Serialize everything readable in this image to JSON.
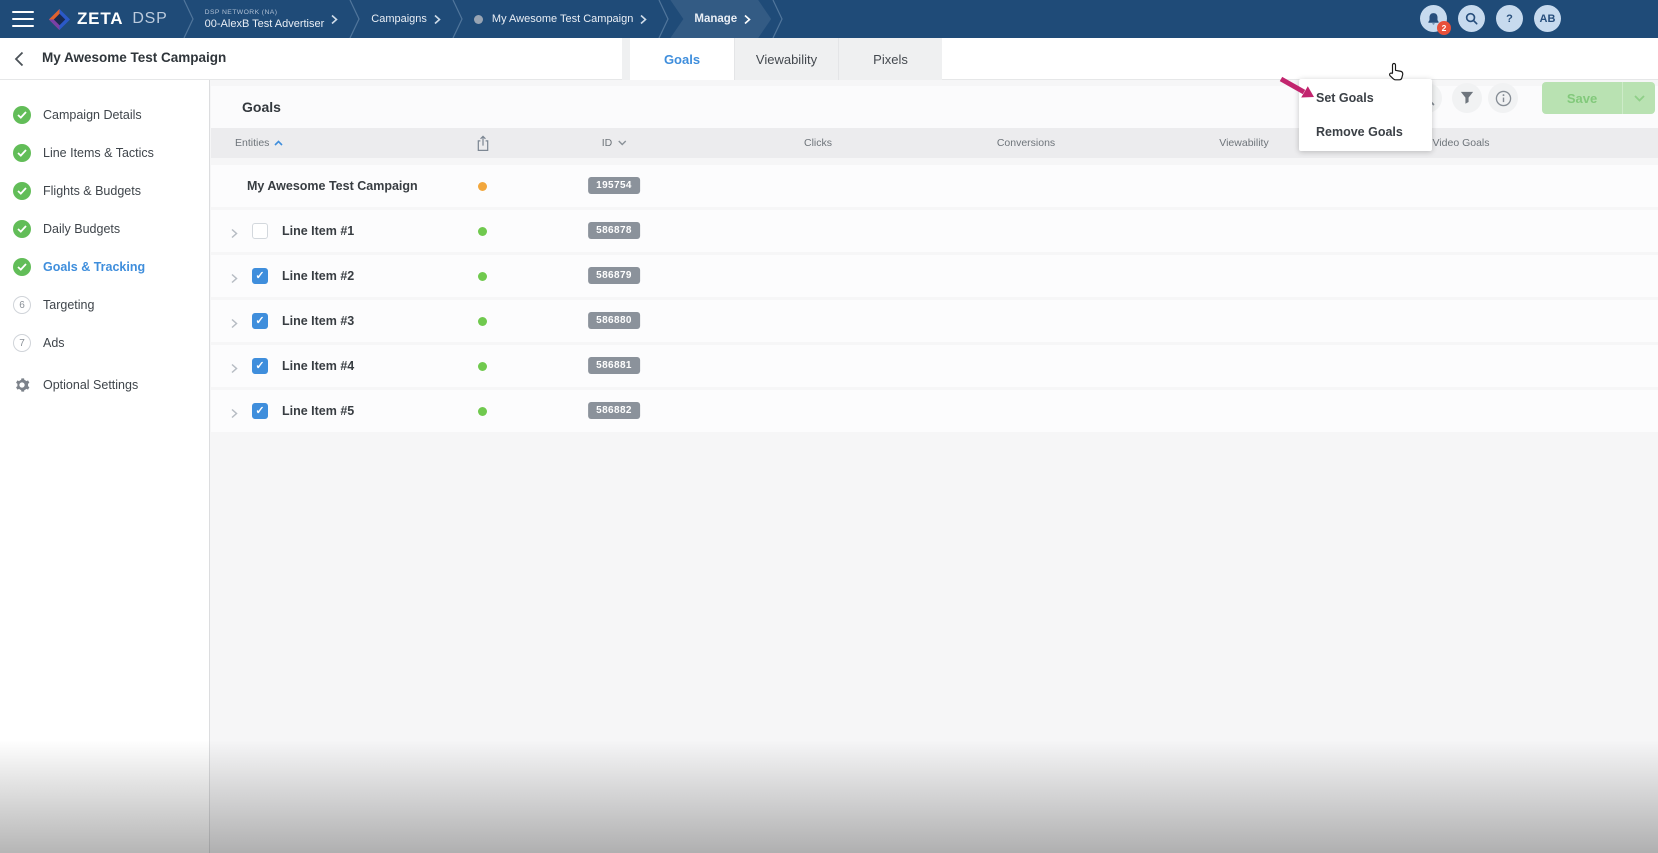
{
  "colors": {
    "topbar_bg": "#1f4b78",
    "accent_blue": "#3f8edc",
    "green": "#62bd58",
    "dot_green": "#70c94e",
    "dot_orange": "#f2a73d",
    "badge_gray": "#8b929b",
    "save_green_bg": "#b9e2b2",
    "save_green_text": "#82c97b",
    "annotation_pink": "#c2256e",
    "notification_red": "#e8503a"
  },
  "topbar": {
    "brand_zeta": "ZETA",
    "brand_dsp": "DSP",
    "breadcrumbs": [
      {
        "eyebrow": "DSP NETWORK (NA)",
        "label": "00-AlexB Test Advertiser",
        "dot": false,
        "active": false
      },
      {
        "label": "Campaigns",
        "dot": false,
        "active": false
      },
      {
        "label": "My Awesome Test Campaign",
        "dot": true,
        "active": false
      },
      {
        "label": "Manage",
        "dot": false,
        "active": true
      }
    ],
    "notification_count": "2",
    "avatar_initials": "AB"
  },
  "header": {
    "title": "My Awesome Test Campaign",
    "tabs": [
      {
        "label": "Goals",
        "active": true
      },
      {
        "label": "Viewability",
        "active": false
      },
      {
        "label": "Pixels",
        "active": false
      }
    ],
    "save_label": "Save"
  },
  "context_menu": {
    "items": [
      "Set Goals",
      "Remove Goals"
    ]
  },
  "sidebar": {
    "items": [
      {
        "label": "Campaign Details",
        "marker": "check",
        "active": false
      },
      {
        "label": "Line Items & Tactics",
        "marker": "check",
        "active": false
      },
      {
        "label": "Flights & Budgets",
        "marker": "check",
        "active": false
      },
      {
        "label": "Daily Budgets",
        "marker": "check",
        "active": false
      },
      {
        "label": "Goals & Tracking",
        "marker": "check",
        "active": true
      },
      {
        "label": "Targeting",
        "marker": "6",
        "active": false
      },
      {
        "label": "Ads",
        "marker": "7",
        "active": false
      },
      {
        "label": "Optional Settings",
        "marker": "gear",
        "active": false
      }
    ]
  },
  "goals_panel": {
    "section_title": "Goals",
    "columns": [
      {
        "label": "Entities",
        "sort": "asc",
        "icon": ""
      },
      {
        "label": "",
        "sort": "",
        "icon": "share"
      },
      {
        "label": "ID",
        "sort": "desc",
        "icon": ""
      },
      {
        "label": "Clicks",
        "sort": "",
        "icon": ""
      },
      {
        "label": "Conversions",
        "sort": "",
        "icon": ""
      },
      {
        "label": "Viewability",
        "sort": "",
        "icon": ""
      },
      {
        "label": "Video Goals",
        "sort": "",
        "icon": ""
      }
    ],
    "rows": [
      {
        "name": "My Awesome Test Campaign",
        "id": "195754",
        "level": "campaign",
        "checked": null,
        "status_color": "#f2a73d"
      },
      {
        "name": "Line Item #1",
        "id": "586878",
        "level": "line-item",
        "checked": false,
        "status_color": "#70c94e"
      },
      {
        "name": "Line Item #2",
        "id": "586879",
        "level": "line-item",
        "checked": true,
        "status_color": "#70c94e"
      },
      {
        "name": "Line Item #3",
        "id": "586880",
        "level": "line-item",
        "checked": true,
        "status_color": "#70c94e"
      },
      {
        "name": "Line Item #4",
        "id": "586881",
        "level": "line-item",
        "checked": true,
        "status_color": "#70c94e"
      },
      {
        "name": "Line Item #5",
        "id": "586882",
        "level": "line-item",
        "checked": true,
        "status_color": "#70c94e"
      }
    ]
  }
}
